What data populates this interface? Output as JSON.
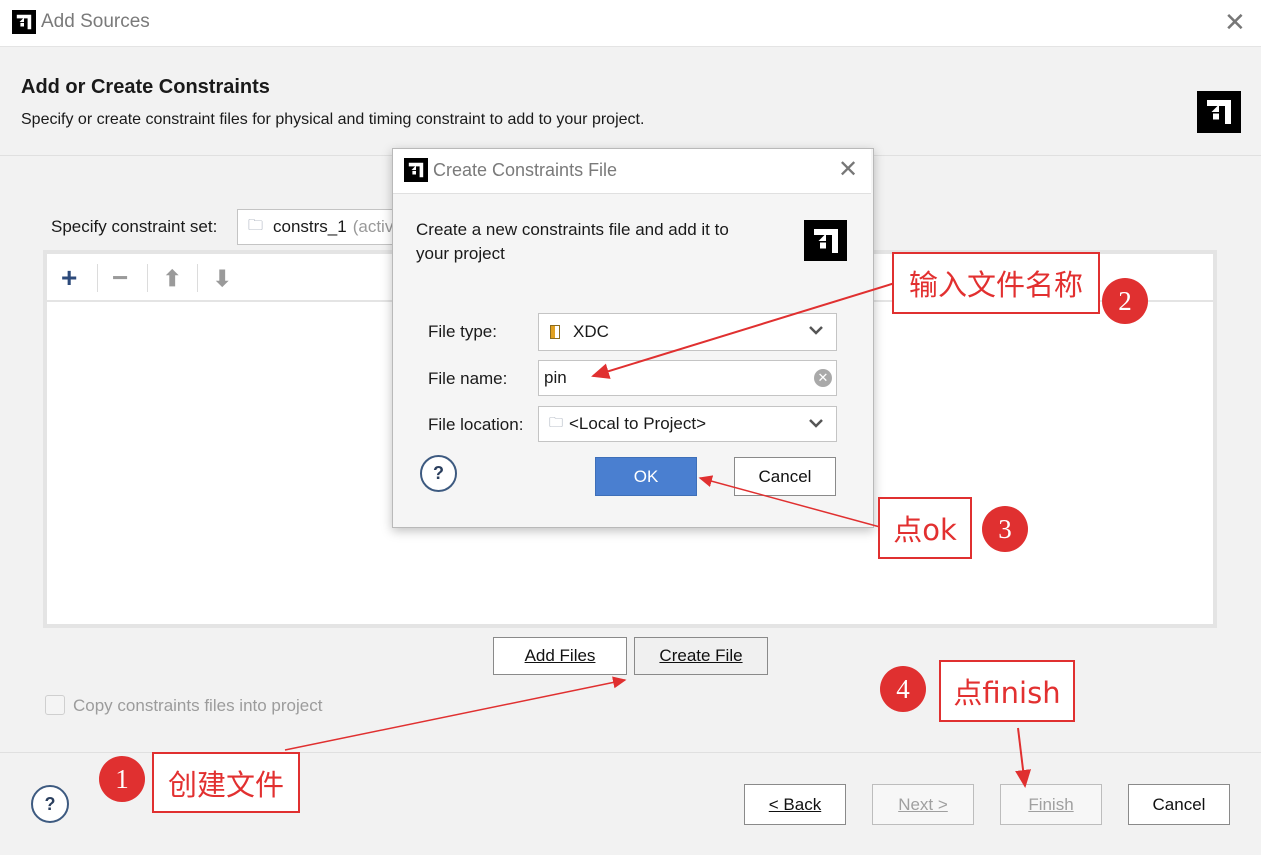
{
  "window": {
    "title": "Add Sources",
    "close_icon": "close-icon",
    "logo_icon": "amd-logo-icon"
  },
  "header": {
    "title": "Add or Create Constraints",
    "description": "Specify or create constraint files for physical and timing constraint to add to your project."
  },
  "constraint_set": {
    "label": "Specify constraint set:",
    "value": "constrs_1",
    "suffix": "(activ"
  },
  "toolbar": {
    "items": [
      "add-icon",
      "remove-icon",
      "move-up-icon",
      "move-down-icon"
    ]
  },
  "buttons": {
    "add_files": "Add Files",
    "create_file": "Create File"
  },
  "copy_checkbox": {
    "label": "Copy constraints files into project",
    "checked": false,
    "enabled": false
  },
  "footer": {
    "help": "?",
    "back": "< Back",
    "next": "Next >",
    "finish": "Finish",
    "cancel": "Cancel"
  },
  "dialog": {
    "title": "Create Constraints File",
    "description": "Create a new constraints file and add it to your project",
    "file_type_label": "File type:",
    "file_type_value": "XDC",
    "file_name_label": "File name:",
    "file_name_value": "pin",
    "file_location_label": "File location:",
    "file_location_value": "<Local to Project>",
    "help": "?",
    "ok": "OK",
    "cancel": "Cancel"
  },
  "annotations": [
    {
      "number": "1",
      "text": "创建文件"
    },
    {
      "number": "2",
      "text": "输入文件名称"
    },
    {
      "number": "3",
      "text": "点ok"
    },
    {
      "number": "4",
      "text": "点finish"
    }
  ],
  "colors": {
    "accent": "#4a7fd0",
    "annotation": "#e03030"
  }
}
